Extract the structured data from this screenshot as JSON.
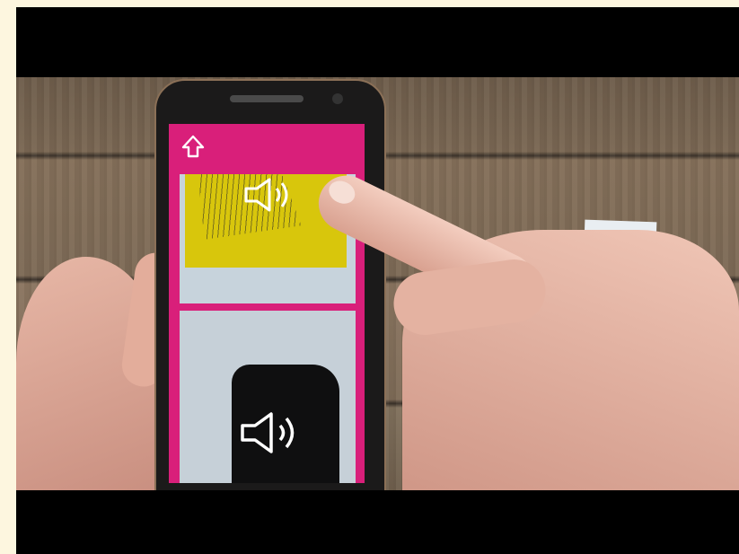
{
  "screen": {
    "app_bar": {
      "icon": "home-outline-icon"
    },
    "cards": [
      {
        "icon": "speaker-icon",
        "theme": "yellow"
      },
      {
        "icon": "speaker-icon",
        "theme": "black"
      }
    ]
  },
  "colors": {
    "app_accent": "#d91f7a",
    "card_yellow": "#d8c60c",
    "card_bg": "#c7d3dc"
  }
}
